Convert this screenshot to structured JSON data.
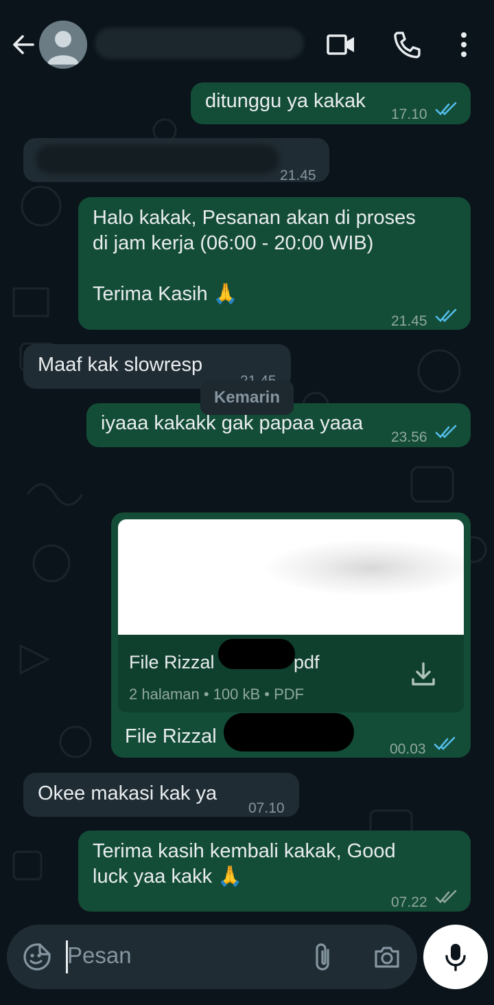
{
  "header": {
    "back_icon": "arrow-left-icon",
    "avatar_icon": "default-avatar-icon",
    "contact_name": "",
    "video_call_icon": "video-camera-icon",
    "voice_call_icon": "phone-icon",
    "menu_icon": "more-vertical-icon"
  },
  "messages": [
    {
      "dir": "out",
      "text": "ditunggu ya kakak",
      "time": "17.10",
      "status": "read"
    },
    {
      "dir": "in",
      "text": "",
      "time": "21.45"
    },
    {
      "dir": "out",
      "text": "Halo kakak, Pesanan akan di proses\ndi jam kerja (06:00 - 20:00 WIB)\n\nTerima Kasih 🙏",
      "time": "21.45",
      "status": "read"
    },
    {
      "dir": "in",
      "text": "Maaf kak slowresp",
      "time": "21.45"
    },
    {
      "dir": "out",
      "text": "iyaaa kakakk gak papaa yaaa",
      "time": "23.56",
      "status": "read"
    },
    {
      "dir": "out",
      "type": "document",
      "file_name": "File Rizzal",
      "file_ext": "pdf",
      "file_meta": "2 halaman • 100 kB • PDF",
      "caption": "File Rizzal",
      "time": "00.03",
      "status": "read"
    },
    {
      "dir": "in",
      "text": "Okee makasi kak ya",
      "time": "07.10"
    },
    {
      "dir": "out",
      "text": "Terima kasih kembali kakak, Good\nluck yaa kakk 🙏",
      "time": "07.22",
      "status": "delivered"
    }
  ],
  "date_separator": "Kemarin",
  "composer": {
    "placeholder": "Pesan",
    "sticker_icon": "sticker-smiley-icon",
    "attach_icon": "paperclip-icon",
    "camera_icon": "camera-icon",
    "mic_icon": "microphone-icon"
  },
  "colors": {
    "background": "#0b141a",
    "outgoing_bubble": "#144d37",
    "incoming_bubble": "#202c33",
    "read_ticks": "#53bdeb",
    "delivered_ticks": "#8696a0"
  }
}
